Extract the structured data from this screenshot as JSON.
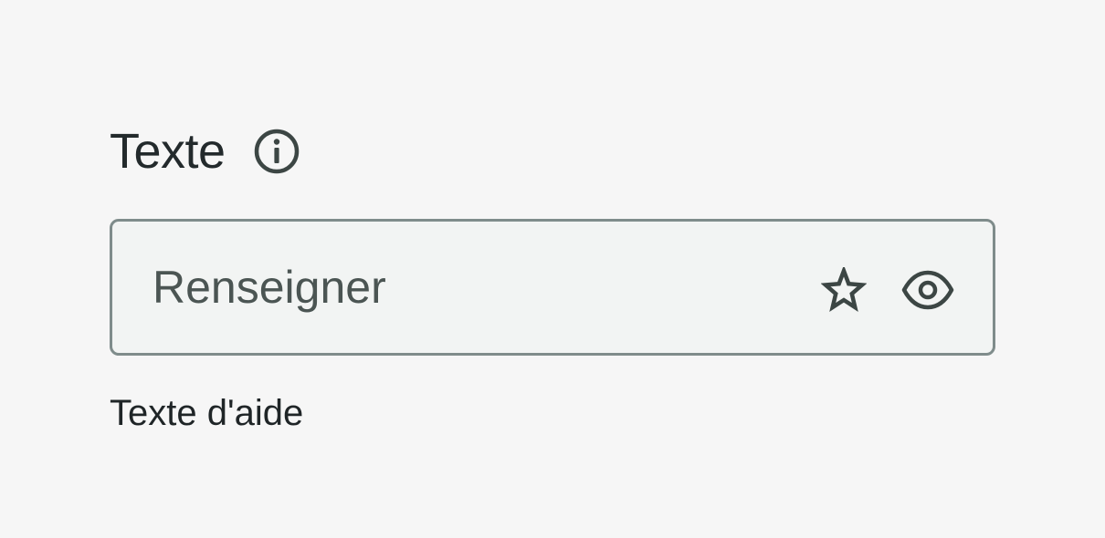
{
  "field": {
    "label": "Texte",
    "placeholder": "Renseigner",
    "value": "",
    "help_text": "Texte d'aide",
    "icons": {
      "info": "info-circle-icon",
      "favorite": "star-icon",
      "visibility": "eye-icon"
    }
  },
  "colors": {
    "background": "#f6f6f6",
    "label": "#232a2c",
    "border": "#7f8c8b",
    "input_bg": "#f2f4f3",
    "icon": "#3c4644"
  }
}
